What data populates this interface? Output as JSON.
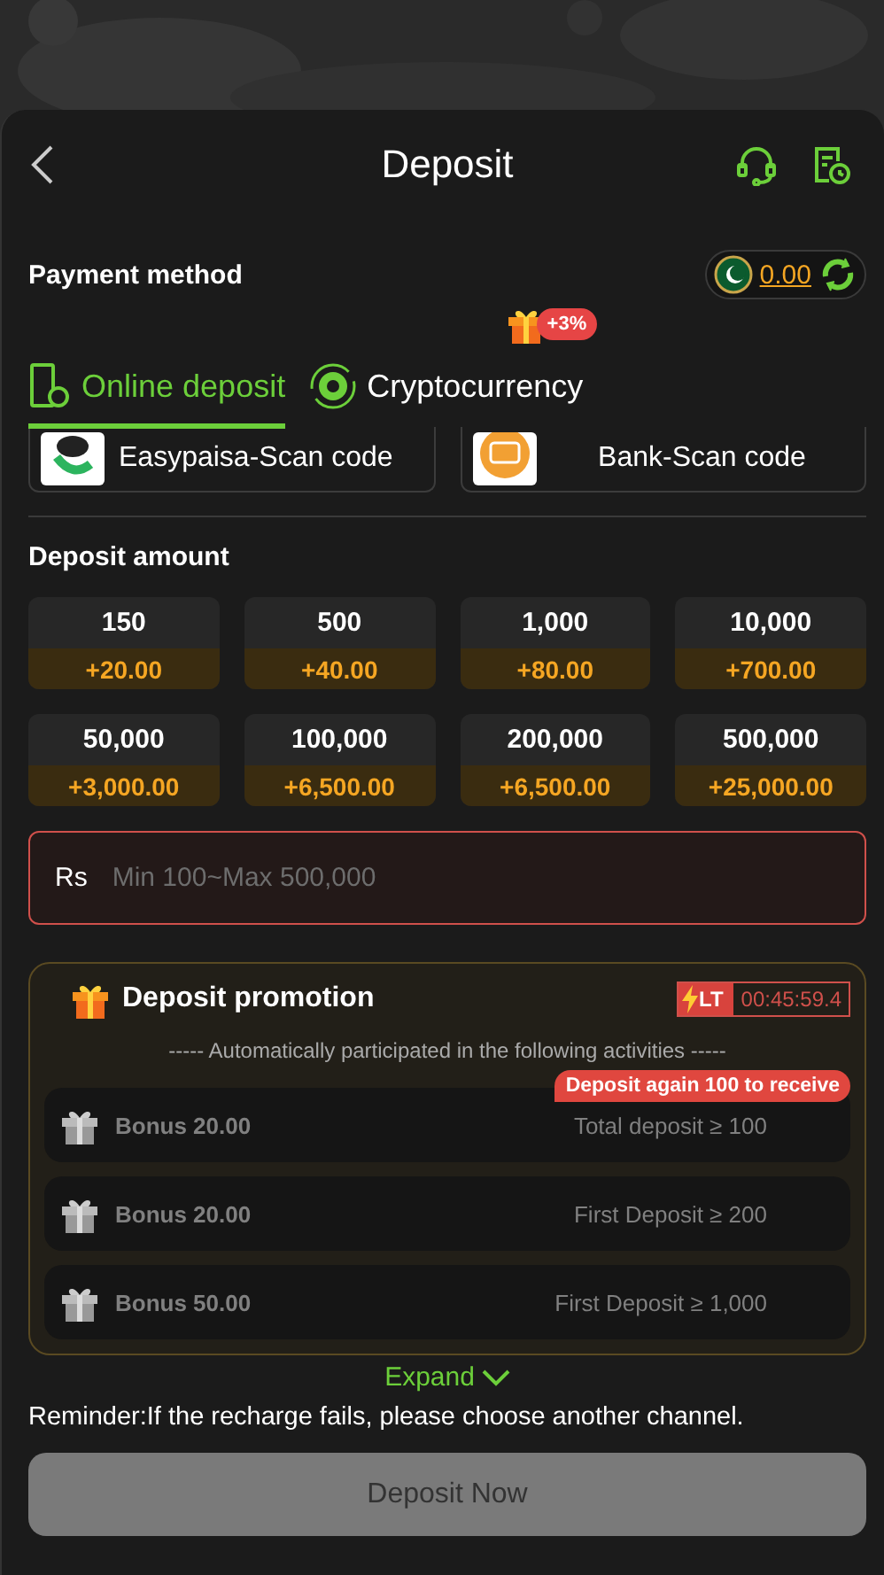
{
  "header": {
    "title": "Deposit"
  },
  "payment": {
    "label": "Payment method",
    "balance": "0.00"
  },
  "tabs": [
    {
      "label": "Online deposit",
      "selected": true,
      "kind": "phone"
    },
    {
      "label": "Cryptocurrency",
      "selected": false,
      "kind": "coin",
      "badge": "+3%"
    }
  ],
  "methods": [
    {
      "label": "Easypaisa-Scan code",
      "kind": "easypaisa"
    },
    {
      "label": "Bank-Scan code",
      "kind": "bank"
    }
  ],
  "amount": {
    "label": "Deposit amount",
    "currency": "Rs",
    "placeholder": "Min 100~Max 500,000"
  },
  "amounts": [
    {
      "value": "150",
      "bonus": "+20.00"
    },
    {
      "value": "500",
      "bonus": "+40.00"
    },
    {
      "value": "1,000",
      "bonus": "+80.00"
    },
    {
      "value": "10,000",
      "bonus": "+700.00"
    },
    {
      "value": "50,000",
      "bonus": "+3,000.00"
    },
    {
      "value": "100,000",
      "bonus": "+6,500.00"
    },
    {
      "value": "200,000",
      "bonus": "+6,500.00"
    },
    {
      "value": "500,000",
      "bonus": "+25,000.00"
    }
  ],
  "promotion": {
    "title": "Deposit promotion",
    "timer_tag": "LT",
    "timer": "00:45:59.4",
    "note": "----- Automatically participated in the following activities -----",
    "items": [
      {
        "bonus": "Bonus 20.00",
        "condition": "Total deposit ≥ 100",
        "tip": "Deposit again 100 to receive"
      },
      {
        "bonus": "Bonus 20.00",
        "condition": "First Deposit ≥ 200"
      },
      {
        "bonus": "Bonus 50.00",
        "condition": "First Deposit ≥ 1,000"
      }
    ]
  },
  "expand": "Expand",
  "reminder": "Reminder:If the recharge fails, please choose another channel.",
  "submit": {
    "label": "Deposit Now",
    "disabled": true
  }
}
